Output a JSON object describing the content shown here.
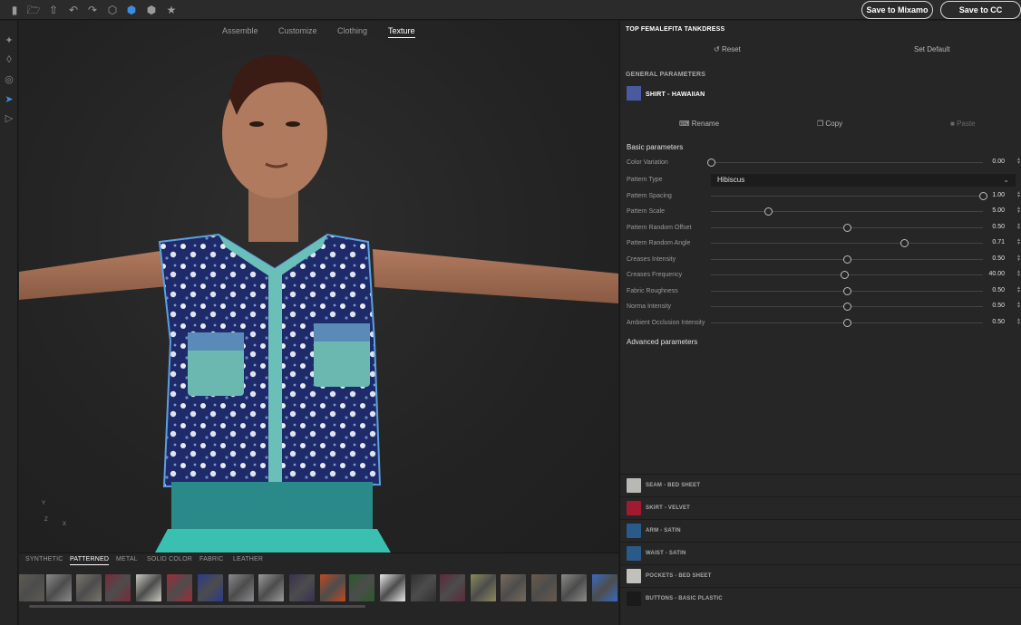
{
  "toolbar": {
    "icons": [
      "puzzle-icon",
      "open-icon",
      "export-icon",
      "undo-icon",
      "redo-icon",
      "cube-outline-icon",
      "cube-blue-icon",
      "cube-grey-icon",
      "star-icon"
    ],
    "save_mixamo_label": "Save to Mixamo",
    "save_cc_label": "Save to CC Libraries"
  },
  "left_tools": [
    "orbit-icon",
    "pan-icon",
    "zoom-icon",
    "select-arrow-icon",
    "camera-icon"
  ],
  "viewport": {
    "tabs": [
      "Assemble",
      "Customize",
      "Clothing",
      "Texture"
    ],
    "active_tab": "Texture",
    "axis": {
      "y": "Y",
      "z": "Z",
      "x": "X"
    }
  },
  "materials": {
    "categories": [
      "SYNTHETIC",
      "PATTERNED",
      "METAL",
      "SOLID COLOR",
      "FABRIC",
      "LEATHER"
    ],
    "active_category": "PATTERNED",
    "swatch_colors": [
      "#5c5a52",
      "#8a8a8a",
      "#7a756c",
      "#7a2a3a",
      "#c8c8c0",
      "#a02a3a",
      "#2a3a8a",
      "#8a8a8e",
      "#9a9a9a",
      "#3a3050",
      "#c04a20",
      "#2a5a2a",
      "#e8e8ea",
      "#303030",
      "#5a2a3a",
      "#8a8a5a",
      "#7a6a5a",
      "#6a5a4a",
      "#8a8a88",
      "#3a6ac0"
    ]
  },
  "panel": {
    "title": "TOP FEMALEFITA TANKDRESS",
    "reset_label": "Reset",
    "set_default_label": "Set Default",
    "general_header": "GENERAL PARAMETERS",
    "material_name": "SHIRT - HAWAIIAN",
    "rename_label": "Rename",
    "copy_label": "Copy",
    "paste_label": "Paste",
    "basic_header": "Basic parameters",
    "advanced_header": "Advanced parameters",
    "color_variation": {
      "label": "Color Variation",
      "value": "0.00",
      "level": 0.0
    },
    "pattern_type": {
      "label": "Pattern Type",
      "value": "Hibiscus"
    },
    "sliders": [
      {
        "label": "Pattern Spacing",
        "value": "1.00",
        "level": 1.0
      },
      {
        "label": "Pattern Scale",
        "value": "5.00",
        "level": 0.21
      },
      {
        "label": "Pattern Random Offset",
        "value": "0.50",
        "level": 0.5
      },
      {
        "label": "Pattern Random Angle",
        "value": "0.71",
        "level": 0.71
      },
      {
        "label": "Creases Intensity",
        "value": "0.50",
        "level": 0.5
      },
      {
        "label": "Creases Frequency",
        "value": "40.00",
        "level": 0.49
      },
      {
        "label": "Fabric Roughness",
        "value": "0.50",
        "level": 0.5
      },
      {
        "label": "Norma Intensity",
        "value": "0.50",
        "level": 0.5
      },
      {
        "label": "Ambient Occlusion Intensity",
        "value": "0.50",
        "level": 0.5
      }
    ],
    "material_list": [
      {
        "label": "SEAM - BED SHEET",
        "color": "#b8b8b4"
      },
      {
        "label": "SKIRT - VELVET",
        "color": "#a01a30"
      },
      {
        "label": "ARM - SATIN",
        "color": "#2a5a8a"
      },
      {
        "label": "WAIST - SATIN",
        "color": "#2a5a8a"
      },
      {
        "label": "POCKETS - BED SHEET",
        "color": "#c0c0bc"
      },
      {
        "label": "BUTTONS - BASIC PLASTIC",
        "color": "#1a1a1a"
      }
    ]
  }
}
